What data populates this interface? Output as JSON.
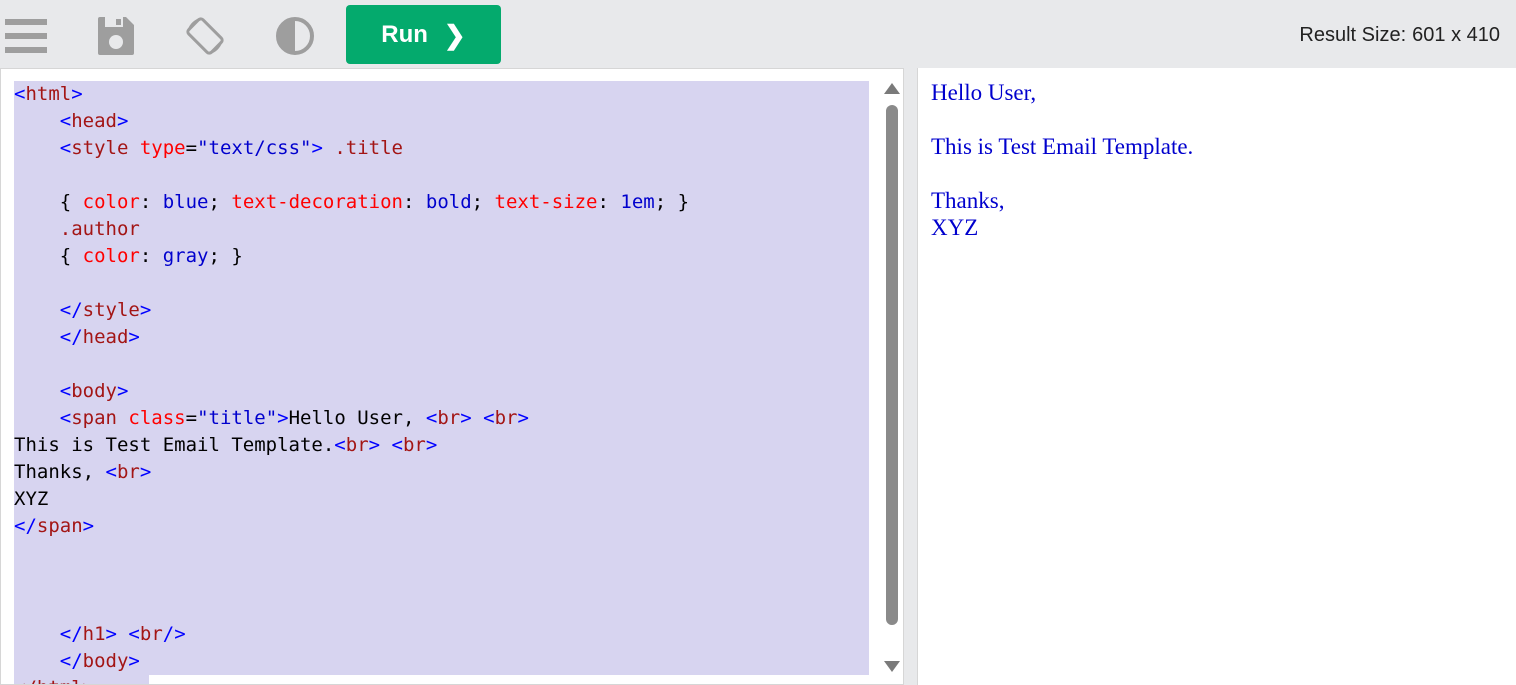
{
  "toolbar": {
    "icons": [
      "menu-icon",
      "save-icon",
      "rotate-icon",
      "contrast-icon"
    ],
    "run_label": "Run",
    "run_chevron": "❯",
    "result_size_label": "Result Size:",
    "result_size_value": "601 x 410",
    "icon_color": "#9e9e9e",
    "run_color": "#04aa6d"
  },
  "editor": {
    "lines": [
      [
        [
          "tk-br",
          "<"
        ],
        [
          "tk-tag",
          "html"
        ],
        [
          "tk-br",
          ">"
        ]
      ],
      [
        [
          "tk-txt",
          "    "
        ],
        [
          "tk-br",
          "<"
        ],
        [
          "tk-tag",
          "head"
        ],
        [
          "tk-br",
          ">"
        ]
      ],
      [
        [
          "tk-txt",
          "    "
        ],
        [
          "tk-br",
          "<"
        ],
        [
          "tk-tag",
          "style "
        ],
        [
          "tk-attr",
          "type"
        ],
        [
          "tk-txt",
          "="
        ],
        [
          "tk-str",
          "\"text/css\""
        ],
        [
          "tk-br",
          ">"
        ],
        [
          "tk-tag",
          " .title"
        ]
      ],
      [
        [
          "tk-txt",
          " "
        ]
      ],
      [
        [
          "tk-txt",
          "    { "
        ],
        [
          "tk-prop",
          "color"
        ],
        [
          "tk-txt",
          ": "
        ],
        [
          "tk-val",
          "blue"
        ],
        [
          "tk-txt",
          "; "
        ],
        [
          "tk-prop",
          "text-decoration"
        ],
        [
          "tk-txt",
          ": "
        ],
        [
          "tk-val",
          "bold"
        ],
        [
          "tk-txt",
          "; "
        ],
        [
          "tk-prop",
          "text-size"
        ],
        [
          "tk-txt",
          ": "
        ],
        [
          "tk-val",
          "1em"
        ],
        [
          "tk-txt",
          "; }"
        ]
      ],
      [
        [
          "tk-txt",
          "    "
        ],
        [
          "tk-tag",
          ".author"
        ]
      ],
      [
        [
          "tk-txt",
          "    { "
        ],
        [
          "tk-prop",
          "color"
        ],
        [
          "tk-txt",
          ": "
        ],
        [
          "tk-val",
          "gray"
        ],
        [
          "tk-txt",
          "; }"
        ]
      ],
      [
        [
          "tk-txt",
          " "
        ]
      ],
      [
        [
          "tk-txt",
          "    "
        ],
        [
          "tk-br",
          "</"
        ],
        [
          "tk-tag",
          "style"
        ],
        [
          "tk-br",
          ">"
        ]
      ],
      [
        [
          "tk-txt",
          "    "
        ],
        [
          "tk-br",
          "</"
        ],
        [
          "tk-tag",
          "head"
        ],
        [
          "tk-br",
          ">"
        ]
      ],
      [
        [
          "tk-txt",
          " "
        ]
      ],
      [
        [
          "tk-txt",
          "    "
        ],
        [
          "tk-br",
          "<"
        ],
        [
          "tk-tag",
          "body"
        ],
        [
          "tk-br",
          ">"
        ]
      ],
      [
        [
          "tk-txt",
          "    "
        ],
        [
          "tk-br",
          "<"
        ],
        [
          "tk-tag",
          "span "
        ],
        [
          "tk-attr",
          "class"
        ],
        [
          "tk-txt",
          "="
        ],
        [
          "tk-str",
          "\"title\""
        ],
        [
          "tk-br",
          ">"
        ],
        [
          "tk-txt",
          "Hello User, "
        ],
        [
          "tk-br",
          "<"
        ],
        [
          "tk-tag",
          "br"
        ],
        [
          "tk-br",
          "> <"
        ],
        [
          "tk-tag",
          "br"
        ],
        [
          "tk-br",
          ">"
        ]
      ],
      [
        [
          "tk-txt",
          "This is Test Email Template."
        ],
        [
          "tk-br",
          "<"
        ],
        [
          "tk-tag",
          "br"
        ],
        [
          "tk-br",
          "> <"
        ],
        [
          "tk-tag",
          "br"
        ],
        [
          "tk-br",
          ">"
        ]
      ],
      [
        [
          "tk-txt",
          "Thanks, "
        ],
        [
          "tk-br",
          "<"
        ],
        [
          "tk-tag",
          "br"
        ],
        [
          "tk-br",
          ">"
        ]
      ],
      [
        [
          "tk-txt",
          "XYZ"
        ]
      ],
      [
        [
          "tk-br",
          "</"
        ],
        [
          "tk-tag",
          "span"
        ],
        [
          "tk-br",
          ">"
        ]
      ],
      [
        [
          "tk-txt",
          " "
        ]
      ],
      [
        [
          "tk-txt",
          " "
        ]
      ],
      [
        [
          "tk-txt",
          " "
        ]
      ],
      [
        [
          "tk-txt",
          "    "
        ],
        [
          "tk-br",
          "</"
        ],
        [
          "tk-tag",
          "h1"
        ],
        [
          "tk-br",
          "> <"
        ],
        [
          "tk-tag",
          "br"
        ],
        [
          "tk-br",
          "/>"
        ]
      ],
      [
        [
          "tk-txt",
          "    "
        ],
        [
          "tk-br",
          "</"
        ],
        [
          "tk-tag",
          "body"
        ],
        [
          "tk-br",
          ">"
        ]
      ]
    ],
    "tail_line": "    </html>"
  },
  "result": {
    "greeting": "Hello User,",
    "body": "This is Test Email Template.",
    "signoff": "Thanks,",
    "name": "XYZ",
    "text_color": "#0000cd"
  }
}
